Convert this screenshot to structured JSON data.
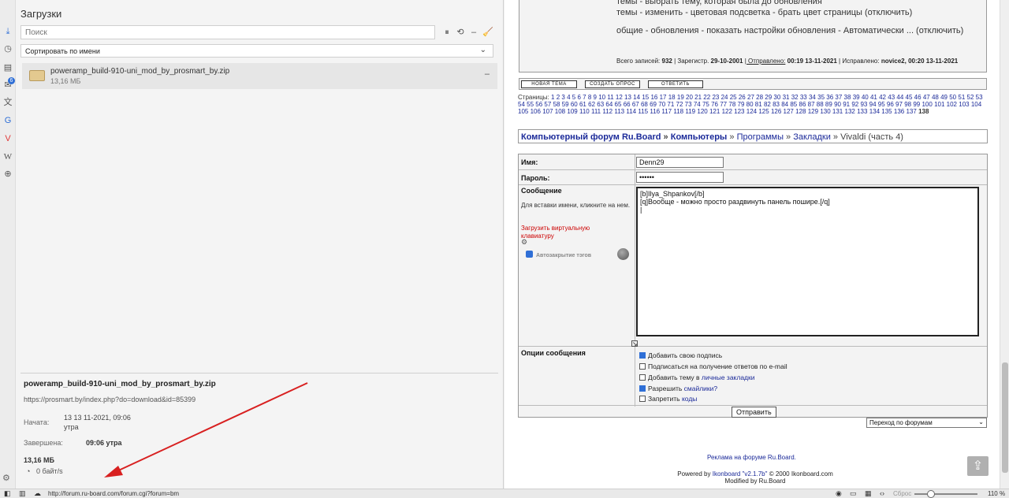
{
  "strip_icons": [
    "download-icon",
    "history-icon",
    "notes-icon",
    "mail-icon",
    "translate-icon",
    "translate2-icon",
    "vivaldi-icon",
    "wikipedia-icon",
    "add-panel-icon"
  ],
  "mail_badge": "6",
  "panel": {
    "title": "Загрузки",
    "search_placeholder": "Поиск",
    "toolbar": [
      "⏸",
      "⟲",
      "–",
      "🧹"
    ],
    "sort_label": "Сортировать по имени",
    "item": {
      "name": "poweramp_build-910-uni_mod_by_prosmart_by.zip",
      "size": "13,16 МБ",
      "action": "–"
    },
    "details": {
      "name": "poweramp_build-910-uni_mod_by_prosmart_by.zip",
      "url": "https://prosmart.by/index.php?do=download&id=85399",
      "started_label": "Начата:",
      "started_value": "13 13 11-2021, 09:06 утра",
      "finished_label": "Завершена:",
      "finished_value": "09:06 утра",
      "size": "13,16 МБ",
      "speed": "0 байт/s"
    }
  },
  "post": {
    "lines": [
      "темы - выбрать тему, которая была до обновления",
      "темы - изменить - цветовая подсветка - брать цвет страницы (отключить)",
      "общие - обновления - показать настройки обновления - Автоматически ... (отключить)"
    ],
    "meta": {
      "posts_label": "Всего записей:",
      "posts": "932",
      "reg_label": "| Зарегистр.",
      "reg": "29-10-2001",
      "sent_label": "| Отправлено:",
      "sent": "00:19 13-11-2021",
      "edit_label": "| Исправлено:",
      "edit": "novice2, 00:20 13-11-2021"
    }
  },
  "buttons": {
    "new_topic": "НОВАЯ ТЕМА",
    "new_poll": "СОЗДАТЬ ОПРОС",
    "reply": "ОТВЕТИТЬ"
  },
  "pages_label": "Страницы:",
  "pages_current": "138",
  "breadcrumb": {
    "forum": "Компьютерный форум Ru.Board",
    "sep1": "»",
    "section": "Компьютеры",
    "sep2": "»",
    "sub": "Программы",
    "sep3": "»",
    "sub2": "Закладки",
    "sep4": "»",
    "topic": "Vivaldi (часть 4)"
  },
  "form": {
    "name_label": "Имя:",
    "name_value": "Denn29",
    "pass_label": "Пароль:",
    "pass_value": "••••••",
    "msg_label": "Сообщение",
    "msg_hint": "Для вставки имени, кликните на нем.",
    "vk_link": "Загрузить виртуальную клавиатуру",
    "autotag": "Автозакрытие тэгов",
    "message": "[b]Ilya_Shpankov[/b]\n[q]Вообще - можно просто раздвинуть панель пошире.[/q]\n|",
    "options_label": "Опции сообщения",
    "opt1": "Добавить свою подпись",
    "opt2": "Подписаться на получение ответов по e-mail",
    "opt3_text": "Добавить тему в",
    "opt3_link": "личные закладки",
    "opt4_text": "Разрешить",
    "opt4_link": "смайлики?",
    "opt5_text": "Запретить",
    "opt5_link": "коды",
    "send": "Отправить"
  },
  "jump": "Переход по форумам",
  "ads": "Реклама на форуме Ru.Board.",
  "powered": {
    "prefix": "Powered by",
    "ikon": "Ikonboard",
    "ver": "\"v2.1.7b\"",
    "rest": "© 2000 Ikonboard.com",
    "modified": "Modified by Ru.Board"
  },
  "statusbar": {
    "url": "http://forum.ru-board.com/forum.cgi?forum=bm",
    "reset": "Сброс",
    "zoom": "110 %"
  }
}
